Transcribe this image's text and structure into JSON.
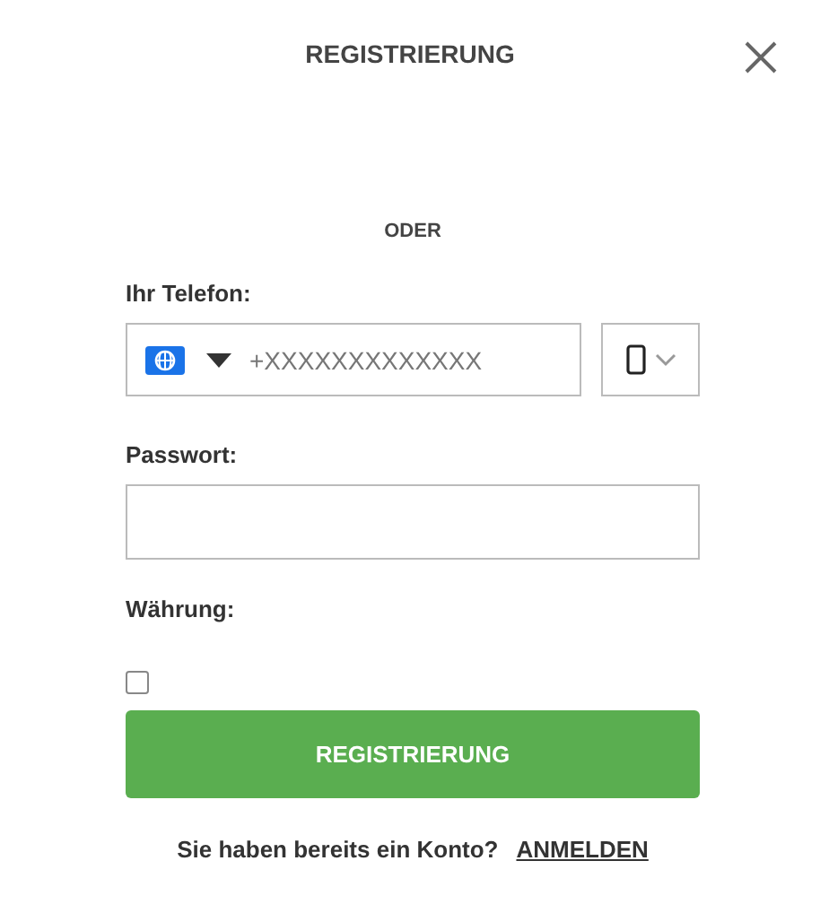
{
  "title": "REGISTRIERUNG",
  "divider_text": "ODER",
  "phone": {
    "label": "Ihr Telefon:",
    "placeholder": "+XXXXXXXXXXXXX"
  },
  "password": {
    "label": "Passwort:"
  },
  "currency": {
    "label": "Währung:"
  },
  "checkbox": {
    "checked": false
  },
  "submit_button": "REGISTRIERUNG",
  "footer": {
    "text": "Sie haben bereits ein Konto?",
    "link": "ANMELDEN"
  }
}
